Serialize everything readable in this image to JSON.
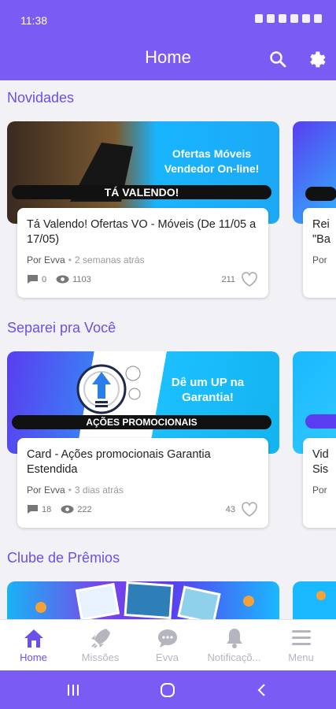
{
  "status_bar": {
    "time": "11:38"
  },
  "app_bar": {
    "title": "Home",
    "search_icon": "search-icon",
    "settings_icon": "gear-icon"
  },
  "colors": {
    "primary": "#7a5cf5",
    "accent_text": "#6b4fe8",
    "inactive": "#b5b5c0"
  },
  "sections": [
    {
      "title": "Novidades",
      "card": {
        "banner_headline": "Ofertas Móveis\nVendedor On-line!",
        "banner_ribbon": "TÁ VALENDO!",
        "title": "Tá Valendo! Ofertas VO - Móveis (De 11/05 a 17/05)",
        "author": "Por Evva",
        "ago": "2 semanas atrás",
        "comments": "0",
        "views": "1103",
        "likes": "211"
      },
      "peek": {
        "title": "Rei",
        "title2": "\"Ba",
        "author": "Por"
      }
    },
    {
      "title": "Separei pra Você",
      "card": {
        "banner_headline": "Dê um UP na\nGarantia!",
        "banner_ribbon": "AÇÕES PROMOCIONAIS",
        "title": "Card - Ações promocionais Garantia Estendida",
        "author": "Por Evva",
        "ago": "3 dias atrás",
        "comments": "18",
        "views": "222",
        "likes": "43"
      },
      "peek": {
        "title": "Vid",
        "title2": "Sis",
        "author": "Por"
      }
    },
    {
      "title": "Clube de Prêmios"
    }
  ],
  "bottom_nav": [
    {
      "label": "Home",
      "icon": "home-icon",
      "active": true
    },
    {
      "label": "Missões",
      "icon": "rocket-icon",
      "active": false
    },
    {
      "label": "Evva",
      "icon": "chat-icon",
      "active": false
    },
    {
      "label": "Notificaçõ...",
      "icon": "bell-icon",
      "active": false
    },
    {
      "label": "Menu",
      "icon": "menu-icon",
      "active": false
    }
  ]
}
